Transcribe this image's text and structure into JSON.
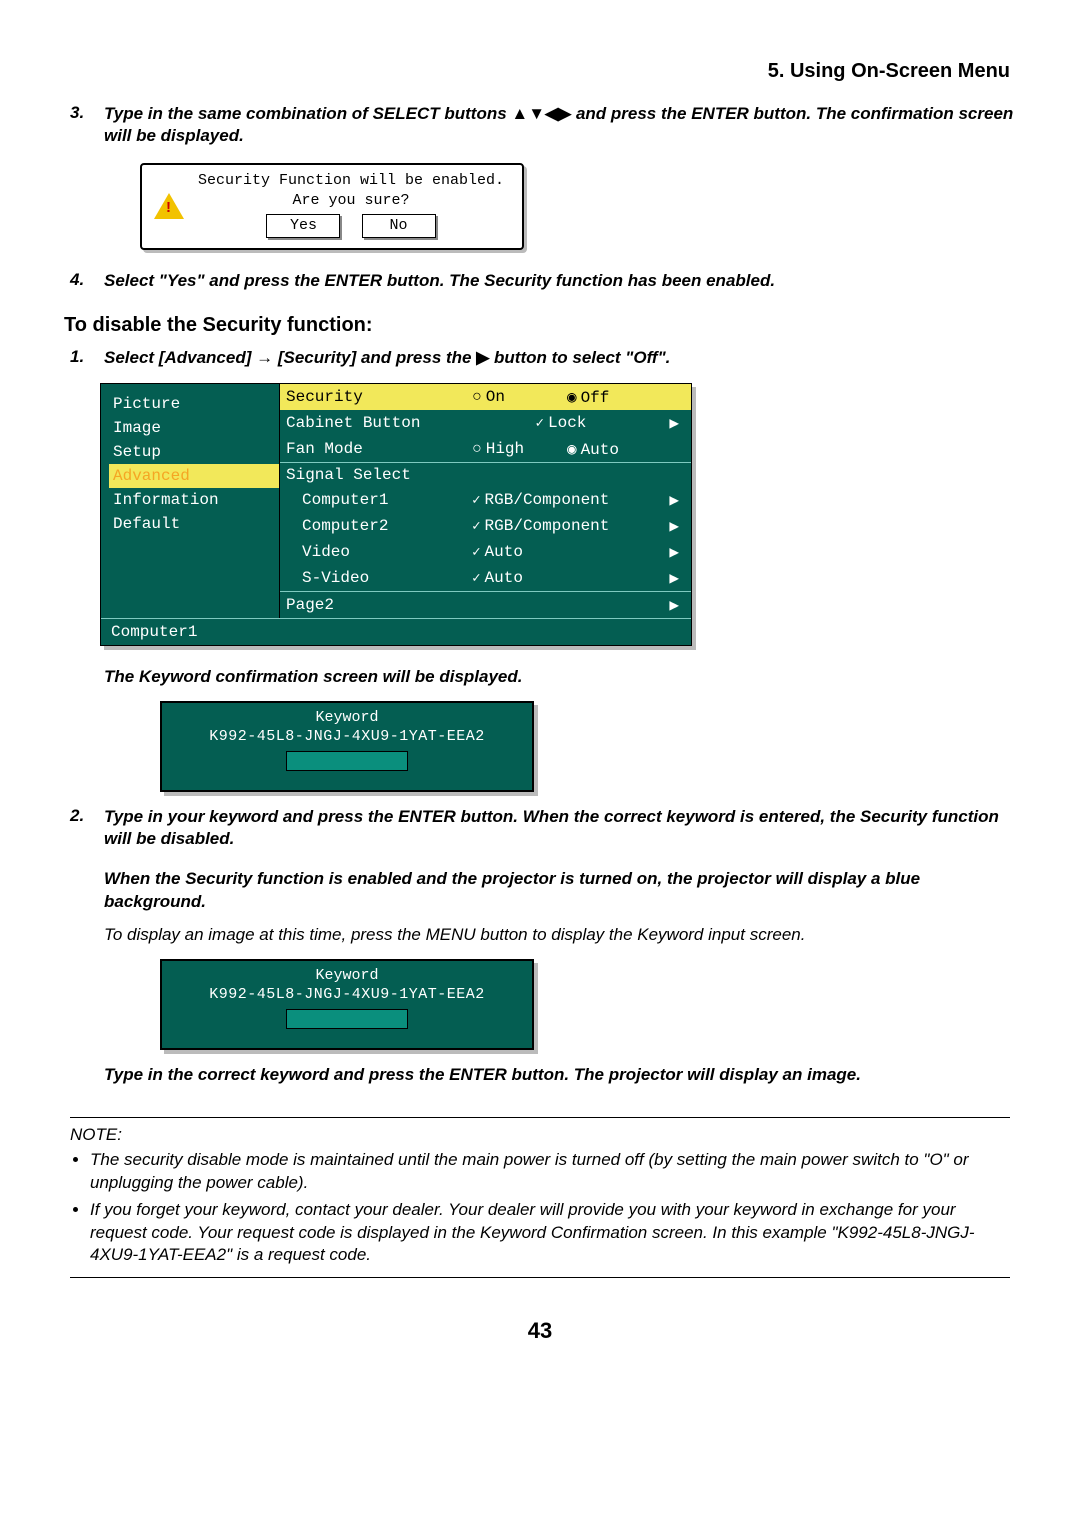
{
  "header": {
    "title": "5. Using On-Screen Menu"
  },
  "step3": {
    "num": "3.",
    "text_a": "Type in the same combination of SELECT buttons ",
    "arrows": "▲▼◀▶",
    "text_b": " and press the ENTER button. The confirmation screen will be displayed."
  },
  "confirm_dialog": {
    "line1": "Security Function will be enabled.",
    "line2": "Are you sure?",
    "yes": "Yes",
    "no": "No"
  },
  "step4": {
    "num": "4.",
    "text": "Select \"Yes\" and press the ENTER button. The Security function has been enabled."
  },
  "disable_heading": "To disable the Security function:",
  "disable_step1": {
    "num": "1.",
    "text_a": "Select [Advanced] → [Security] and press the ",
    "arrow": "▶",
    "text_b": " button to select \"Off\"."
  },
  "menu": {
    "left": {
      "items": [
        {
          "label": "Picture",
          "sel": false,
          "orange": false
        },
        {
          "label": "Image",
          "sel": false,
          "orange": false
        },
        {
          "label": "Setup",
          "sel": false,
          "orange": false
        },
        {
          "label": "Advanced",
          "sel": true,
          "orange": true
        },
        {
          "label": "Information",
          "sel": false,
          "orange": false
        },
        {
          "label": "Default",
          "sel": false,
          "orange": false
        }
      ]
    },
    "right": {
      "security": {
        "label": "Security",
        "on": "On",
        "off": "Off"
      },
      "cabinet": {
        "label": "Cabinet Button",
        "value": "Lock"
      },
      "fan": {
        "label": "Fan Mode",
        "high": "High",
        "auto": "Auto"
      },
      "signal": {
        "label": "Signal Select"
      },
      "rows": [
        {
          "label": "Computer1",
          "value": "RGB/Component"
        },
        {
          "label": "Computer2",
          "value": "RGB/Component"
        },
        {
          "label": "Video",
          "value": "Auto"
        },
        {
          "label": "S-Video",
          "value": "Auto"
        }
      ],
      "page2": "Page2"
    },
    "status": "Computer1"
  },
  "kw_confirm_text": "The Keyword confirmation screen will be displayed.",
  "keyword_dialog": {
    "title": "Keyword",
    "code": "K992-45L8-JNGJ-4XU9-1YAT-EEA2"
  },
  "disable_step2": {
    "num": "2.",
    "text": "Type in your keyword and press the ENTER button. When the correct keyword is entered, the Security function will be disabled."
  },
  "blue_bg_text": "When the Security function is enabled and the projector is turned on, the projector will display a blue background.",
  "display_image_text": "To display an image at this time, press the MENU button to display the Keyword input screen.",
  "final_text": "Type in the correct keyword and press the ENTER button. The projector will display an image.",
  "note": {
    "label": "NOTE:",
    "b1": "The security disable mode is maintained until the main power is turned off (by setting the main power switch to \"O\" or unplugging the power cable).",
    "b2": "If you forget your keyword, contact your dealer. Your dealer will provide you with your keyword in exchange for your request code. Your request code is displayed in the Keyword Confirmation screen. In this example \"K992-45L8-JNGJ-4XU9-1YAT-EEA2\" is a request code."
  },
  "page_number": "43"
}
